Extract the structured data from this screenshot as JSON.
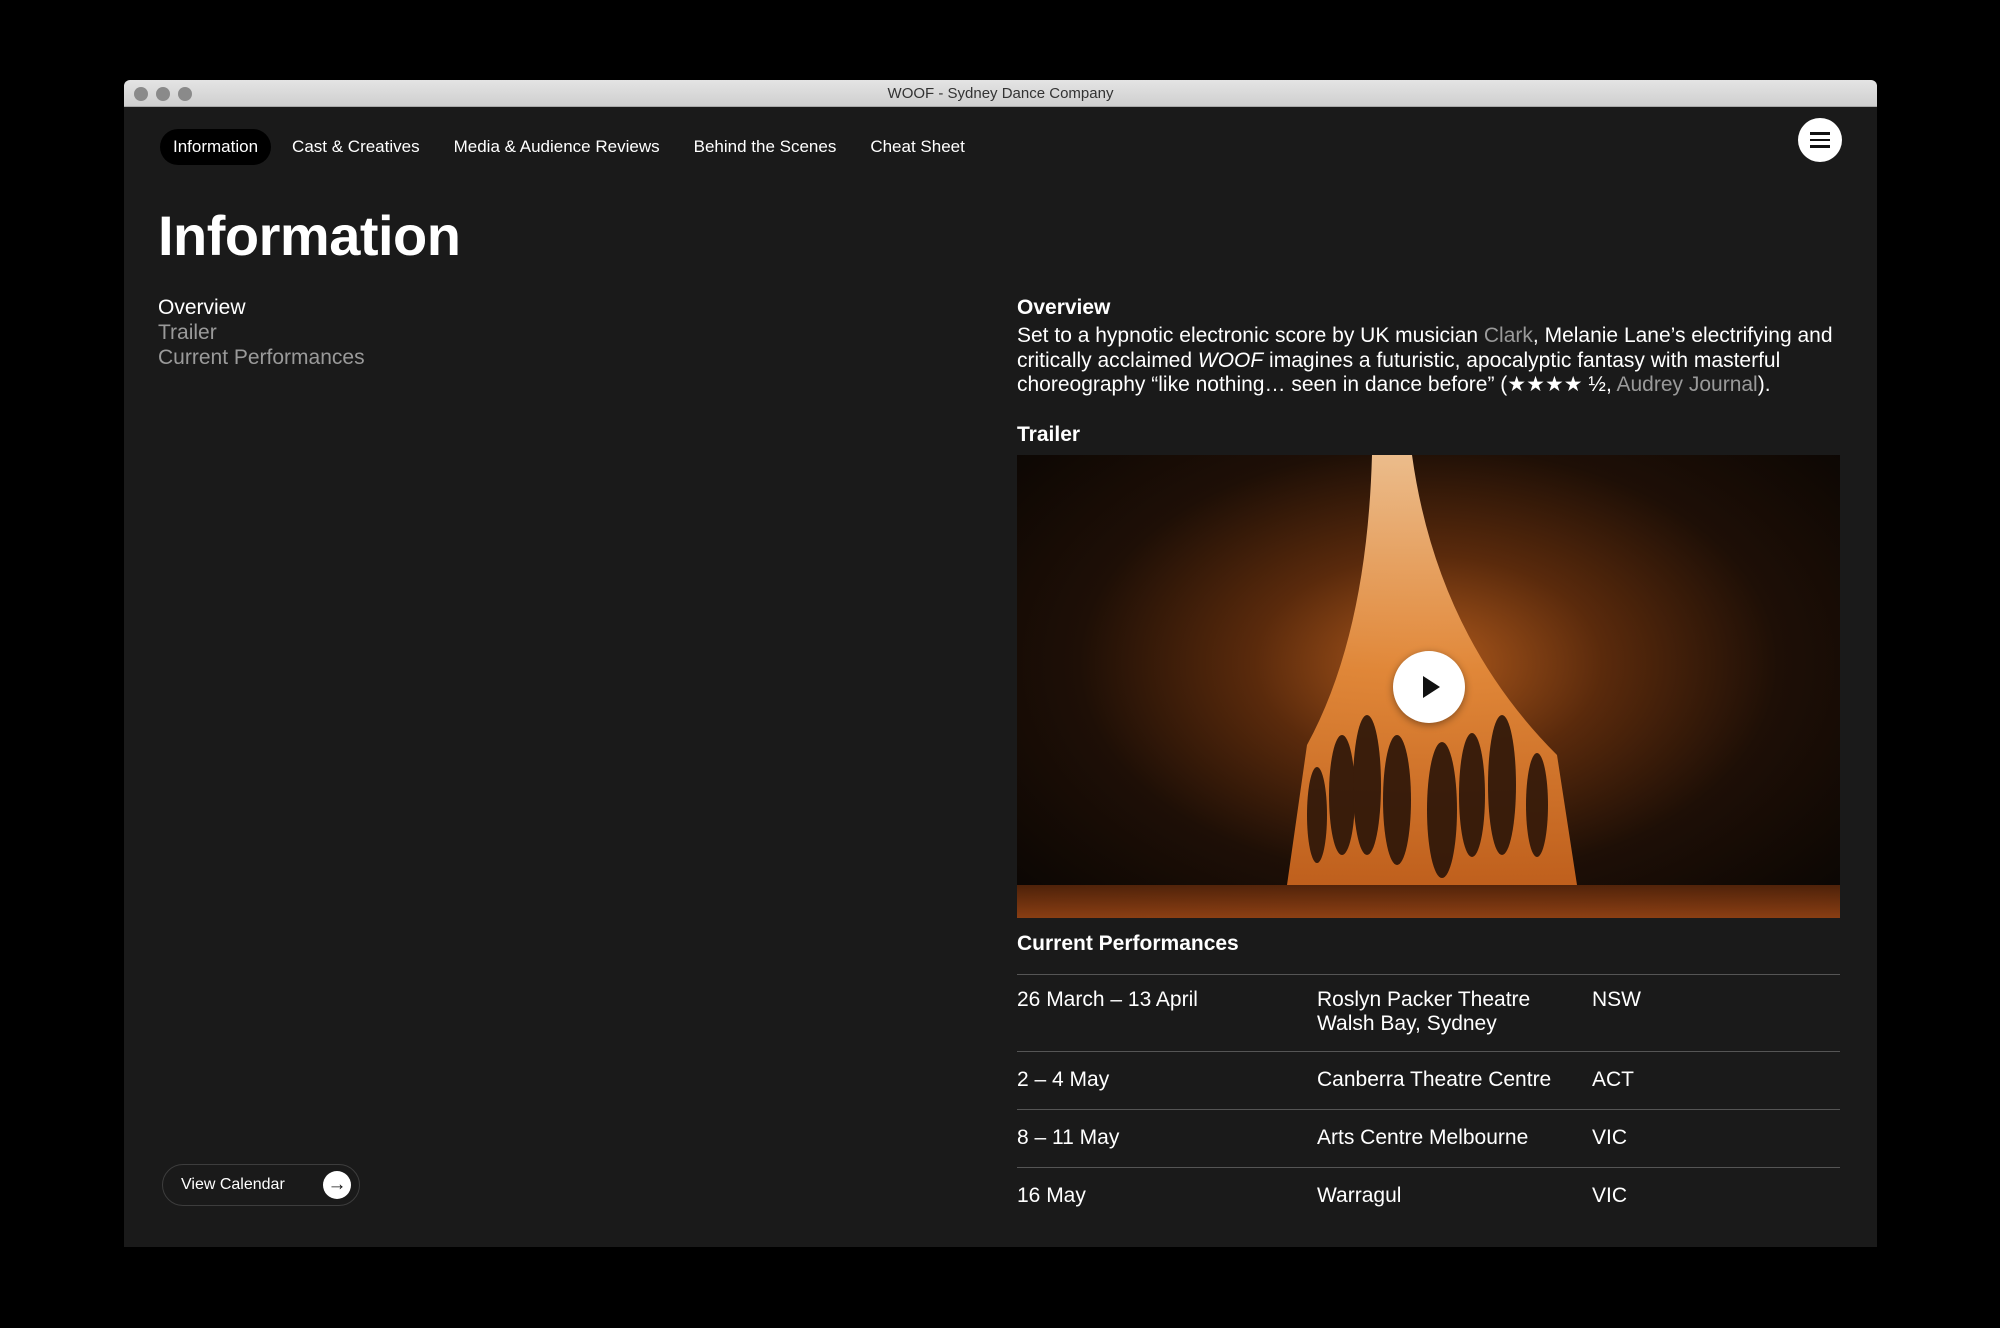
{
  "window": {
    "title": "WOOF - Sydney Dance Company"
  },
  "nav": {
    "tabs": [
      {
        "label": "Information",
        "active": true
      },
      {
        "label": "Cast & Creatives",
        "active": false
      },
      {
        "label": "Media & Audience Reviews",
        "active": false
      },
      {
        "label": "Behind the Scenes",
        "active": false
      },
      {
        "label": "Cheat Sheet",
        "active": false
      }
    ],
    "menu_icon": "hamburger-menu-icon"
  },
  "page": {
    "title": "Information"
  },
  "toc": {
    "items": [
      "Overview",
      "Trailer",
      "Current Performances"
    ]
  },
  "calendar_button": {
    "label": "View Calendar",
    "icon": "arrow-right-icon"
  },
  "overview": {
    "heading": "Overview",
    "text_1": "Set to a hypnotic electronic score by UK musician ",
    "link_1": "Clark",
    "text_2": ", Melanie Lane’s electrifying and critically acclaimed ",
    "title_italic": "WOOF",
    "text_3": " imagines a futuristic, apocalyptic fantasy with masterful choreography “like nothing… seen in dance before” (★★★★ ½, ",
    "link_2": "Audrey Journal",
    "text_4": ")."
  },
  "trailer": {
    "heading": "Trailer",
    "play_icon": "play-icon"
  },
  "performances": {
    "heading": "Current Performances",
    "rows": [
      {
        "dates": "26 March – 13 April",
        "venue": "Roslyn Packer Theatre",
        "venue_line2": "Walsh Bay, Sydney",
        "state": "NSW"
      },
      {
        "dates": "2 – 4 May",
        "venue": "Canberra Theatre Centre",
        "state": "ACT"
      },
      {
        "dates": "8 – 11 May",
        "venue": "Arts Centre Melbourne",
        "state": "VIC"
      },
      {
        "dates": "16 May",
        "venue": "Warragul",
        "state": "VIC"
      }
    ]
  },
  "colors": {
    "background": "#1a1a1a",
    "muted_text": "#9a9a9a",
    "accent_orange": "#d9731f"
  }
}
